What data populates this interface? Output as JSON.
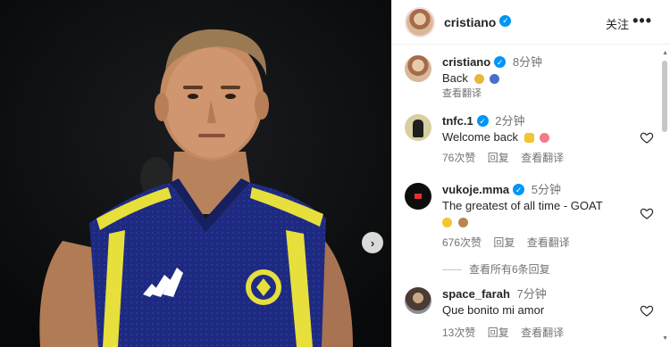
{
  "post": {
    "author": "cristiano",
    "follow_label": "关注",
    "more_label": "•••"
  },
  "photo": {
    "next_glyph": "›"
  },
  "caption": {
    "username": "cristiano",
    "time": "8分钟",
    "text": "Back",
    "translate_label": "查看翻译"
  },
  "comments": [
    {
      "username": "tnfc.1",
      "time": "2分钟",
      "text": "Welcome back",
      "likes": "76次赞",
      "reply_label": "回复",
      "translate_label": "查看翻译"
    },
    {
      "username": "vukoje.mma",
      "time": "5分钟",
      "text": "The greatest of all time - GOAT",
      "likes": "676次赞",
      "reply_label": "回复",
      "translate_label": "查看翻译",
      "view_replies": "查看所有6条回复"
    },
    {
      "username": "space_farah",
      "time": "7分钟",
      "text": "Que bonito mi amor",
      "likes": "13次赞",
      "reply_label": "回复",
      "translate_label": "查看翻译"
    }
  ],
  "colors": {
    "verified": "#0095f6",
    "jersey": "#1f2c86",
    "jersey_trim": "#e9e23a",
    "muted_text": "#737373"
  }
}
